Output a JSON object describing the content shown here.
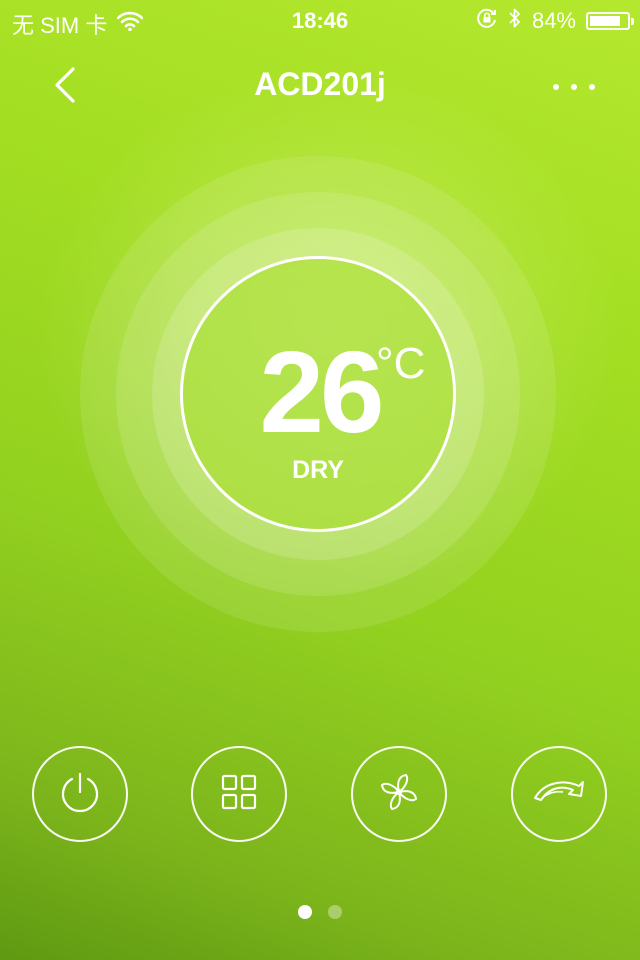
{
  "status_bar": {
    "carrier": "无 SIM 卡",
    "time": "18:46",
    "battery_percent": "84%",
    "battery_level": 0.84,
    "icons": [
      "wifi-icon",
      "rotation-lock-icon",
      "bluetooth-icon",
      "battery-icon"
    ]
  },
  "nav": {
    "title": "ACD201j",
    "back_icon": "chevron-left-icon",
    "more_icon": "more-dots-icon"
  },
  "thermostat": {
    "temperature": "26",
    "unit": "°C",
    "mode": "DRY"
  },
  "controls": [
    {
      "name": "power-button",
      "icon": "power-icon"
    },
    {
      "name": "mode-button",
      "icon": "grid-icon"
    },
    {
      "name": "fan-button",
      "icon": "fan-icon"
    },
    {
      "name": "swing-button",
      "icon": "swing-arrow-icon"
    }
  ],
  "pagination": {
    "total": 2,
    "active": 1
  },
  "colors": {
    "accent": "#a3de22",
    "dark_accent": "#5e9912",
    "foreground": "#ffffff"
  }
}
